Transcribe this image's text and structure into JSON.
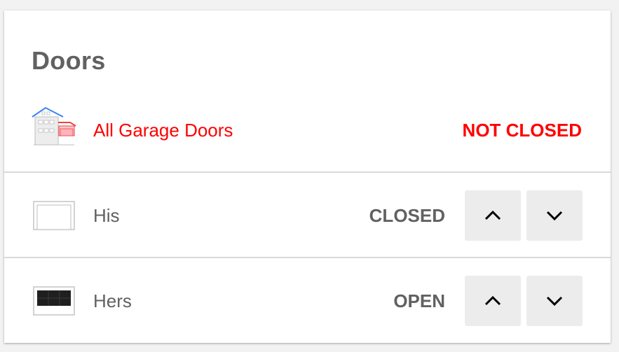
{
  "card": {
    "title": "Doors"
  },
  "group": {
    "name": "All Garage Doors",
    "state": "NOT CLOSED",
    "icon": "house-garage-icon",
    "color": "#ff0000"
  },
  "doors": [
    {
      "name": "His",
      "state": "CLOSED",
      "icon": "garage-door-closed-icon",
      "up_icon": "chevron-up-icon",
      "down_icon": "chevron-down-icon"
    },
    {
      "name": "Hers",
      "state": "OPEN",
      "icon": "garage-door-open-icon",
      "up_icon": "chevron-up-icon",
      "down_icon": "chevron-down-icon"
    }
  ],
  "colors": {
    "text": "#616161",
    "alert": "#ff0000",
    "button_bg": "#ececec",
    "divider": "#d9d9d9"
  }
}
